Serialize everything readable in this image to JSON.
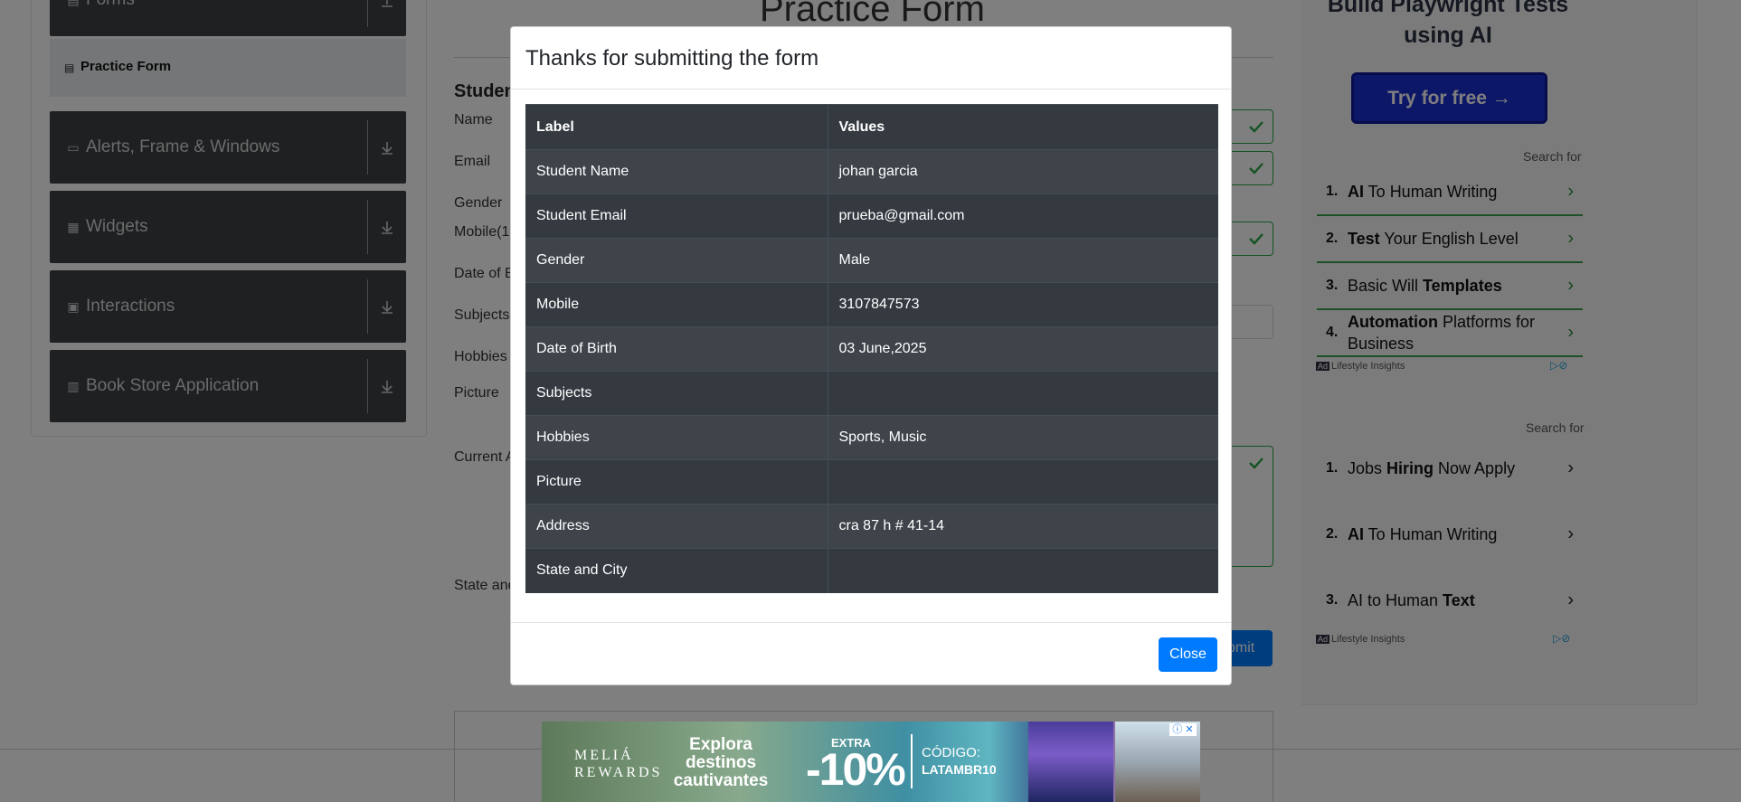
{
  "sidebar": {
    "forms_label": "Forms",
    "active_item": "Practice Form",
    "groups": [
      {
        "label": "Alerts, Frame & Windows",
        "icon": "window-icon"
      },
      {
        "label": "Widgets",
        "icon": "widgets-icon"
      },
      {
        "label": "Interactions",
        "icon": "interactions-icon"
      },
      {
        "label": "Book Store Application",
        "icon": "books-icon"
      }
    ]
  },
  "form": {
    "title": "Practice Form",
    "heading": "Studen",
    "labels": {
      "name": "Name",
      "email": "Email",
      "gender": "Gender",
      "mobile": "Mobile(1",
      "dob": "Date of B",
      "subjects": "Subjects",
      "hobbies": "Hobbies",
      "picture": "Picture",
      "address": "Current A",
      "state": "State and"
    },
    "submit_label": "bmit"
  },
  "right_ad": {
    "headline": "Build Playwright Tests using AI",
    "cta": "Try for free →",
    "search_for": "Search for",
    "group1": [
      {
        "num": "1.",
        "bold": "AI",
        "rest": " To Human Writing"
      },
      {
        "num": "2.",
        "bold": "Test",
        "rest": " Your English Level"
      },
      {
        "num": "3.",
        "pre": "Basic Will ",
        "bold": "Templates"
      },
      {
        "num": "4.",
        "bold": "Automation",
        "rest": " Platforms for Business"
      }
    ],
    "group2": [
      {
        "num": "1.",
        "pre": "Jobs ",
        "bold": "Hiring",
        "rest": " Now Apply"
      },
      {
        "num": "2.",
        "bold": "AI",
        "rest": " To Human Writing"
      },
      {
        "num": "3.",
        "pre": "AI to Human ",
        "bold": "Text"
      }
    ],
    "footer_brand": "Lifestyle Insights",
    "ad_badge": "Ad"
  },
  "banner_ad": {
    "logo_line1": "MELIÁ",
    "logo_line2": "REWARDS",
    "text": "Explora destinos cautivantes",
    "extra": "EXTRA",
    "discount": "-10%",
    "code_label": "CÓDIGO:",
    "code": "LATAMBR10"
  },
  "modal": {
    "title": "Thanks for submitting the form",
    "columns": [
      "Label",
      "Values"
    ],
    "rows": [
      {
        "label": "Student Name",
        "value": "johan garcia"
      },
      {
        "label": "Student Email",
        "value": "prueba@gmail.com"
      },
      {
        "label": "Gender",
        "value": "Male"
      },
      {
        "label": "Mobile",
        "value": "3107847573"
      },
      {
        "label": "Date of Birth",
        "value": "03 June,2025"
      },
      {
        "label": "Subjects",
        "value": ""
      },
      {
        "label": "Hobbies",
        "value": "Sports, Music"
      },
      {
        "label": "Picture",
        "value": ""
      },
      {
        "label": "Address",
        "value": "cra 87 h # 41-14"
      },
      {
        "label": "State and City",
        "value": ""
      }
    ],
    "close_label": "Close"
  },
  "colors": {
    "primary": "#007bff",
    "table_dark": "#343a40",
    "sidebar_group": "#3c4144",
    "valid": "#28a745"
  }
}
